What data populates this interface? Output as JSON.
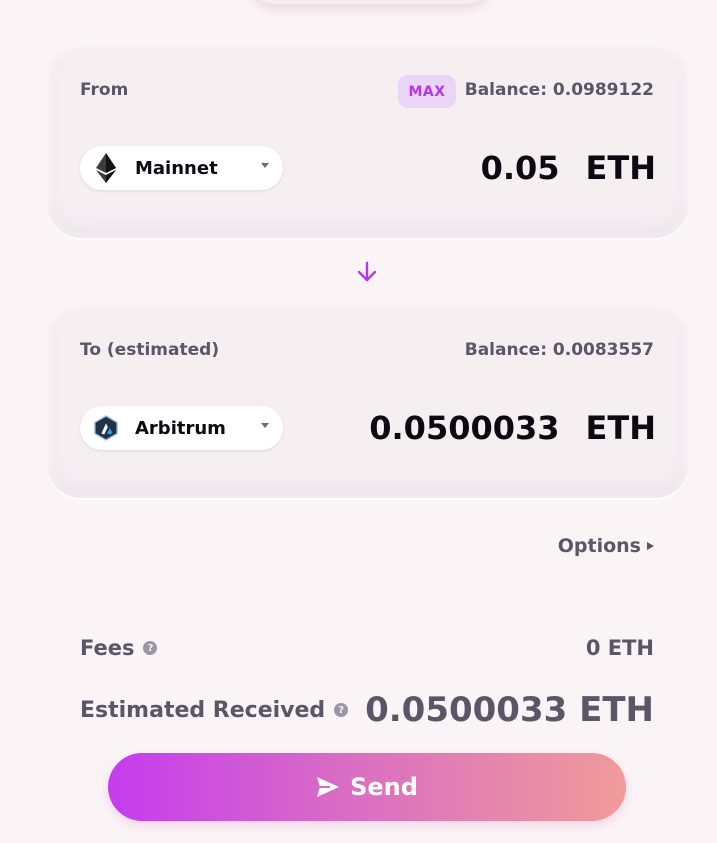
{
  "from": {
    "label": "From",
    "max_label": "MAX",
    "balance": "Balance: 0.0989122",
    "network": "Mainnet",
    "network_icon": "ethereum-icon",
    "amount": "0.05",
    "unit": "ETH"
  },
  "swap_icon": "arrow-down-icon",
  "to": {
    "label": "To (estimated)",
    "balance": "Balance: 0.0083557",
    "network": "Arbitrum",
    "network_icon": "arbitrum-icon",
    "amount": "0.0500033",
    "unit": "ETH"
  },
  "options_label": "Options",
  "fees": {
    "label": "Fees",
    "value": "0 ETH"
  },
  "estimated_received": {
    "label": "Estimated Received",
    "value": "0.0500033 ETH"
  },
  "send_label": "Send",
  "colors": {
    "accent": "#b536ec",
    "button_gradient_start": "#c43cef",
    "button_gradient_end": "#f09b9a",
    "background": "#fbf4f6"
  }
}
